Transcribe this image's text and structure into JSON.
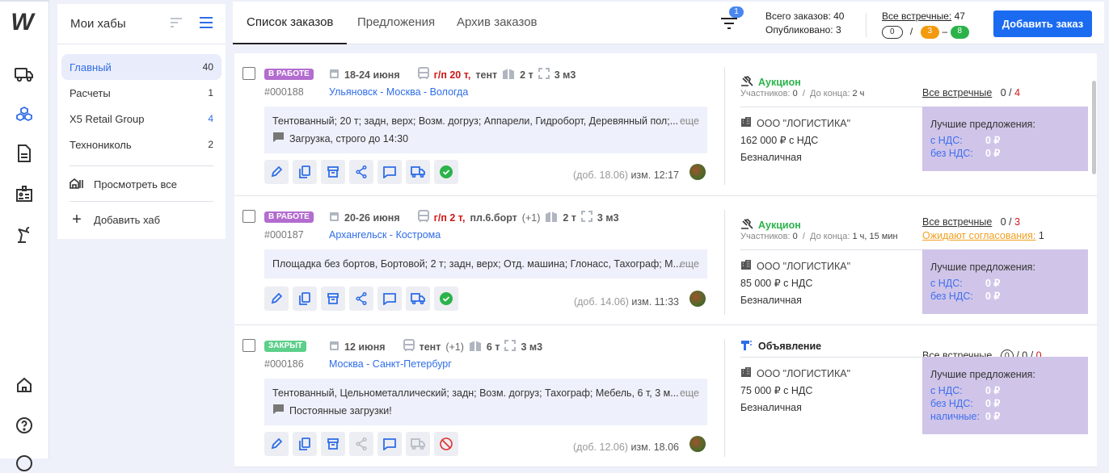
{
  "rail": {
    "logo": "W",
    "items": [
      "truck-icon",
      "cubes-icon",
      "document-icon",
      "id-badge-icon",
      "robot-arm-icon",
      "home-icon",
      "help-icon"
    ]
  },
  "hubs": {
    "title": "Мои хабы",
    "items": [
      {
        "label": "Главный",
        "count": "40"
      },
      {
        "label": "Расчеты",
        "count": "1"
      },
      {
        "label": "X5 Retail Group",
        "count": "4"
      },
      {
        "label": "Технониколь",
        "count": "2"
      }
    ],
    "view_all": "Просмотреть все",
    "add": "Добавить хаб"
  },
  "header": {
    "tabs": [
      "Список заказов",
      "Предложения",
      "Архив заказов"
    ],
    "filter_badge": "1",
    "total": "Всего заказов: 40",
    "published": "Опубликовано: 3",
    "counter_link": "Все встречные:",
    "counter_total": "47",
    "pill_gray": "0",
    "pill_sep": "/",
    "pill_orange": "3",
    "pill_dash": "–",
    "pill_green": "8",
    "add_button": "Добавить заказ"
  },
  "colors": {
    "accent": "#1a6bf0",
    "in_work": "#b36ccf",
    "closed": "#5ccf8a",
    "auction": "#2bb34a",
    "purple_box": "#d0c5e8"
  },
  "orders": [
    {
      "status": "В РАБОТЕ",
      "status_kind": "in_work",
      "date": "18-24 июня",
      "truck_red": "г/п 20 т,",
      "truck_rest": "тент",
      "truck_extra": "",
      "weight": "2 т",
      "volume": "3 м3",
      "id": "#000188",
      "route": "Ульяновск - Москва - Вологда",
      "desc": "Тентованный; 20 т; задн, верх; Возм. догруз; Аппарели, Гидроборт, Деревянный пол;...",
      "more": "еще",
      "comment": "Загрузка, строго до 14:30",
      "added": "(доб. 18.06)",
      "changed": "изм. 12:17",
      "closed": false,
      "type": "Аукцион",
      "participants_label": "Участников:",
      "participants": "0",
      "end_label": "До конца:",
      "end": "2 ч",
      "counter_label": "Все встречные",
      "counter_a": "0",
      "counter_b": "4",
      "waiting_label": "",
      "waiting": "",
      "company": "ООО \"ЛОГИСТИКА\"",
      "price": "162 000 ₽ с НДС",
      "payment": "Безналичная",
      "best_title": "Лучшие предложения:",
      "best": [
        {
          "k": "с НДС:",
          "v": "0 ₽"
        },
        {
          "k": "без НДС:",
          "v": "0 ₽"
        }
      ]
    },
    {
      "status": "В РАБОТЕ",
      "status_kind": "in_work",
      "date": "20-26 июня",
      "truck_red": "г/п 2 т,",
      "truck_rest": "пл.6.борт",
      "truck_extra": "(+1)",
      "weight": "2 т",
      "volume": "3 м3",
      "id": "#000187",
      "route": "Архангельск - Кострома",
      "desc": "Площадка без бортов, Бортовой; 2 т; задн, верх; Отд. машина; Глонасс, Тахограф; М...",
      "more": "еще",
      "comment": "",
      "added": "(доб. 14.06)",
      "changed": "изм. 11:33",
      "closed": false,
      "type": "Аукцион",
      "participants_label": "Участников:",
      "participants": "0",
      "end_label": "До конца:",
      "end": "1 ч, 15 мин",
      "counter_label": "Все встречные",
      "counter_a": "0",
      "counter_b": "3",
      "waiting_label": "Ожидают согласования:",
      "waiting": "1",
      "company": "ООО \"ЛОГИСТИКА\"",
      "price": "85 000 ₽ с НДС",
      "payment": "Безналичная",
      "best_title": "Лучшие предложения:",
      "best": [
        {
          "k": "с НДС:",
          "v": "0 ₽"
        },
        {
          "k": "без НДС:",
          "v": "0 ₽"
        }
      ]
    },
    {
      "status": "ЗАКРЫТ",
      "status_kind": "closed",
      "date": "12 июня",
      "truck_red": "",
      "truck_rest": "тент",
      "truck_extra": "(+1)",
      "weight": "6 т",
      "volume": "3 м3",
      "id": "#000186",
      "route": "Москва - Санкт-Петербург",
      "desc": "Тентованный, Цельнометаллический; задн; Возм. догруз; Тахограф; Мебель, 6 т, 3 м...",
      "more": "еще",
      "comment": "Постоянные загрузки!",
      "added": "(доб. 12.06)",
      "changed": "изм. 18.06",
      "closed": true,
      "type": "Объявление",
      "participants_label": "",
      "participants": "",
      "end_label": "",
      "end": "",
      "counter_label": "Все встречные",
      "counter_circle": "0",
      "counter_a": "0",
      "counter_b": "0",
      "waiting_label": "",
      "waiting": "",
      "company": "ООО \"ЛОГИСТИКА\"",
      "price": "75 000 ₽ с НДС",
      "payment": "Безналичная",
      "best_title": "Лучшие предложения:",
      "best": [
        {
          "k": "с НДС:",
          "v": "0 ₽"
        },
        {
          "k": "без НДС:",
          "v": "0 ₽"
        },
        {
          "k": "наличные:",
          "v": "0 ₽"
        }
      ]
    }
  ]
}
